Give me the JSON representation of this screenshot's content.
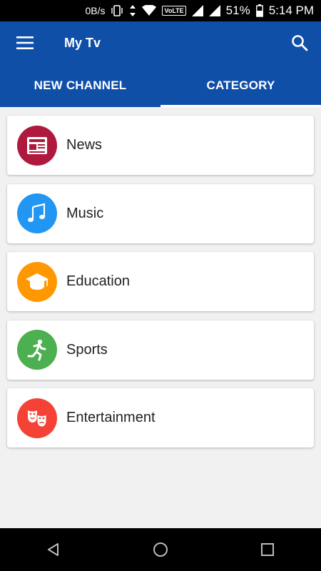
{
  "status_bar": {
    "net_speed": "0B/s",
    "volte": "VoLTE",
    "battery": "51%",
    "time": "5:14 PM"
  },
  "app_bar": {
    "title": "My Tv"
  },
  "tabs": [
    {
      "label": "NEW CHANNEL",
      "active": false
    },
    {
      "label": "CATEGORY",
      "active": true
    }
  ],
  "categories": [
    {
      "label": "News",
      "icon": "newspaper-icon",
      "color": "#b0193e"
    },
    {
      "label": "Music",
      "icon": "music-note-icon",
      "color": "#2196f3"
    },
    {
      "label": "Education",
      "icon": "graduation-cap-icon",
      "color": "#ff9800"
    },
    {
      "label": "Sports",
      "icon": "running-person-icon",
      "color": "#4caf50"
    },
    {
      "label": "Entertainment",
      "icon": "theater-masks-icon",
      "color": "#f44336"
    }
  ],
  "colors": {
    "primary": "#0f4fa8",
    "background": "#f1f1f1"
  }
}
